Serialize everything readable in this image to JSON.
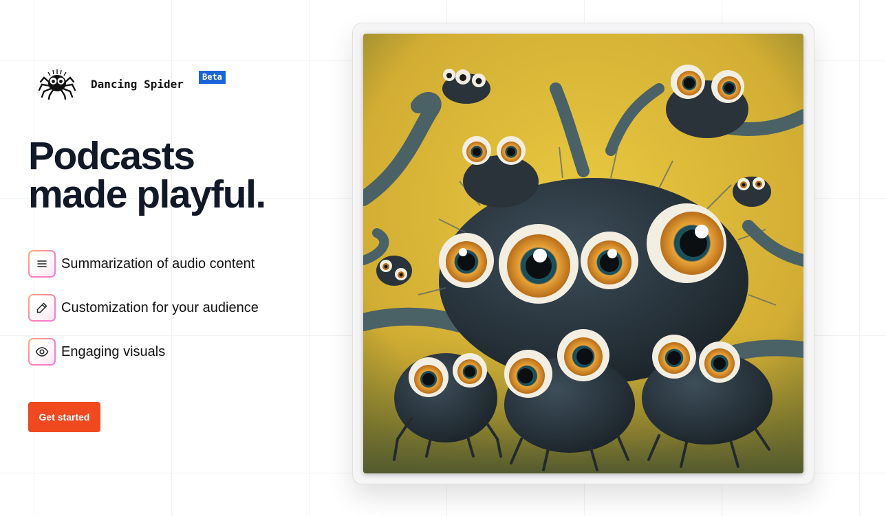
{
  "brand": {
    "name": "Dancing Spider",
    "badge": "Beta",
    "logo_icon": "spider-logo-icon"
  },
  "hero": {
    "title_line1": "Podcasts",
    "title_line2": "made playful."
  },
  "features": [
    {
      "icon": "list-lines-icon",
      "label": "Summarization of audio content"
    },
    {
      "icon": "pencil-icon",
      "label": "Customization for your audience"
    },
    {
      "icon": "eye-icon",
      "label": "Engaging visuals"
    }
  ],
  "cta": {
    "label": "Get started"
  },
  "colors": {
    "cta": "#f0481f",
    "badge": "#1d63d8",
    "heading": "#111827",
    "artwork_background": "#d9b83a"
  },
  "artwork": {
    "subject": "fuzzy-spider-creatures-illustration"
  }
}
